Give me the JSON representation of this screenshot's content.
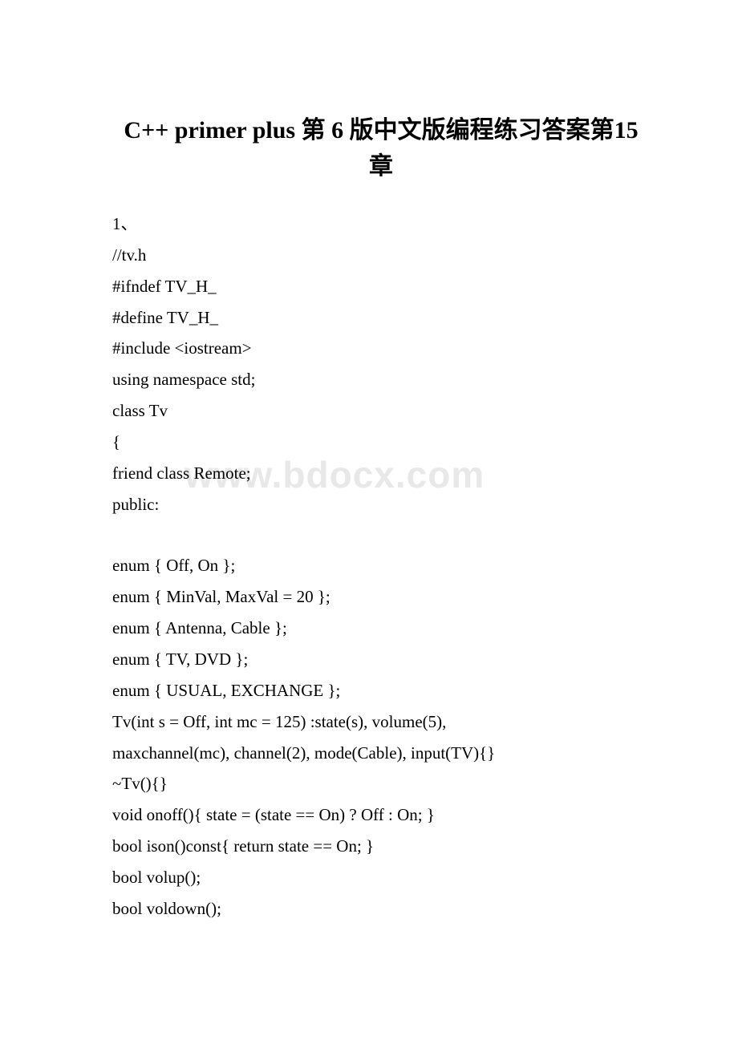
{
  "title": "C++ primer plus 第 6 版中文版编程练习答案第15 章",
  "watermark": "www.bdocx.com",
  "lines": [
    "1、",
    "//tv.h",
    "#ifndef TV_H_",
    "#define TV_H_",
    "#include <iostream>",
    "using namespace std;",
    "class Tv",
    "{",
    " friend class Remote;",
    "public:",
    "",
    " enum { Off, On };",
    " enum { MinVal, MaxVal = 20 };",
    " enum { Antenna, Cable };",
    " enum { TV, DVD };",
    " enum { USUAL, EXCHANGE };",
    " Tv(int s = Off, int mc = 125) :state(s), volume(5),",
    "  maxchannel(mc), channel(2), mode(Cable), input(TV){}",
    " ~Tv(){}",
    " void onoff(){ state = (state == On) ? Off : On; }",
    " bool ison()const{ return state == On; }",
    " bool volup();",
    " bool voldown();"
  ]
}
